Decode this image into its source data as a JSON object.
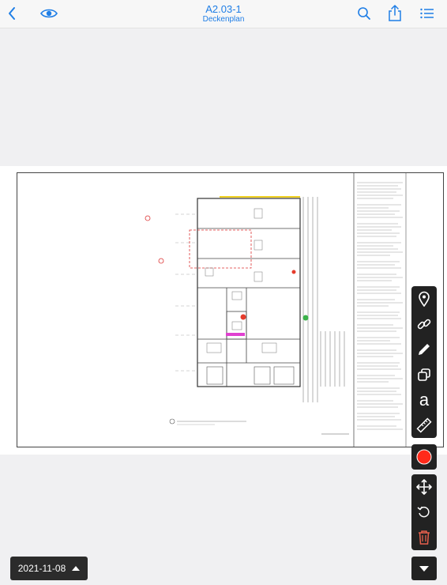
{
  "header": {
    "title": "A2.03-1",
    "subtitle": "Deckenplan",
    "accent_color": "#1f7ee6"
  },
  "icons": {
    "back": "chevron-left-icon",
    "visibility": "eye-icon",
    "search": "search-icon",
    "share": "share-icon",
    "list": "list-icon"
  },
  "tools": [
    {
      "name": "pin-tool-icon"
    },
    {
      "name": "link-tool-icon"
    },
    {
      "name": "pencil-tool-icon"
    },
    {
      "name": "duplicate-tool-icon"
    },
    {
      "name": "text-tool-icon",
      "label": "a"
    },
    {
      "name": "ruler-tool-icon"
    }
  ],
  "color_tool": {
    "name": "color-picker-icon",
    "color": "#ff2a1a"
  },
  "edit_tools": [
    {
      "name": "move-icon"
    },
    {
      "name": "undo-icon"
    },
    {
      "name": "delete-icon",
      "color": "#e8604c"
    }
  ],
  "footer": {
    "date": "2021-11-08"
  }
}
